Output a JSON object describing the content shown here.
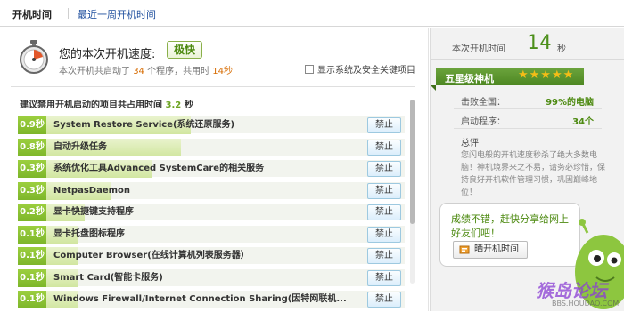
{
  "tabs": {
    "active": "开机时间",
    "link": "最近一周开机时间"
  },
  "summary_header": {
    "title": "您的本次开机速度:",
    "badge": "极快",
    "info_prefix": "本次开机共启动了",
    "program_count": "34",
    "info_mid": "个程序，共用时",
    "time_used": "14秒",
    "checkbox_label": "显示系统及安全关键项目"
  },
  "suggest": {
    "label": "建议禁用开机启动的项目共占用时间",
    "value": "3.2",
    "unit": "秒"
  },
  "items": [
    {
      "secs": "0.9秒",
      "name": "System Restore Service(系统还原服务)",
      "fill": 0.45,
      "action": "禁止"
    },
    {
      "secs": "0.8秒",
      "name": "自动升级任务",
      "fill": 0.42,
      "action": "禁止"
    },
    {
      "secs": "0.3秒",
      "name": "系统优化工具Advanced SystemCare的相关服务",
      "fill": 0.33,
      "action": "禁止"
    },
    {
      "secs": "0.3秒",
      "name": "NetpasDaemon",
      "fill": 0.2,
      "action": "禁止"
    },
    {
      "secs": "0.2秒",
      "name": "显卡快捷键支持程序",
      "fill": 0.12,
      "action": "禁止"
    },
    {
      "secs": "0.1秒",
      "name": "显卡托盘图标程序",
      "fill": 0.1,
      "action": "禁止"
    },
    {
      "secs": "0.1秒",
      "name": "Computer Browser(在线计算机列表服务器）",
      "fill": 0.1,
      "action": "禁止"
    },
    {
      "secs": "0.1秒",
      "name": "Smart Card(智能卡服务)",
      "fill": 0.1,
      "action": "禁止"
    },
    {
      "secs": "0.1秒",
      "name": "Windows Firewall/Internet Connection Sharing(因特网联机...",
      "fill": 0.1,
      "action": "禁止"
    }
  ],
  "side": {
    "boot_label": "本次开机时间",
    "boot_value": "14",
    "boot_unit": "秒",
    "rank": "五星级神机",
    "stars": "★★★★★",
    "beat_label": "击败全国：",
    "beat_value": "99%的电脑",
    "startup_label": "启动程序：",
    "startup_value": "34个",
    "comment_title": "总评",
    "comment": "您闪电般的开机速度秒杀了绝大多数电脑！神机境界来之不易，请务必珍惜，保持良好开机软件管理习惯，巩固巅峰地位！",
    "bubble_text": "成绩不错，赶快分享给网上好友们吧！",
    "share_button": "晒开机时间"
  },
  "watermark": {
    "text": "猴岛论坛",
    "url": "BBS.HOUDAO.COM"
  },
  "colors": {
    "accent_green": "#7db62a",
    "rank_green": "#4d8722",
    "link_blue": "#1f4f9e",
    "star_gold": "#f5bd16"
  }
}
